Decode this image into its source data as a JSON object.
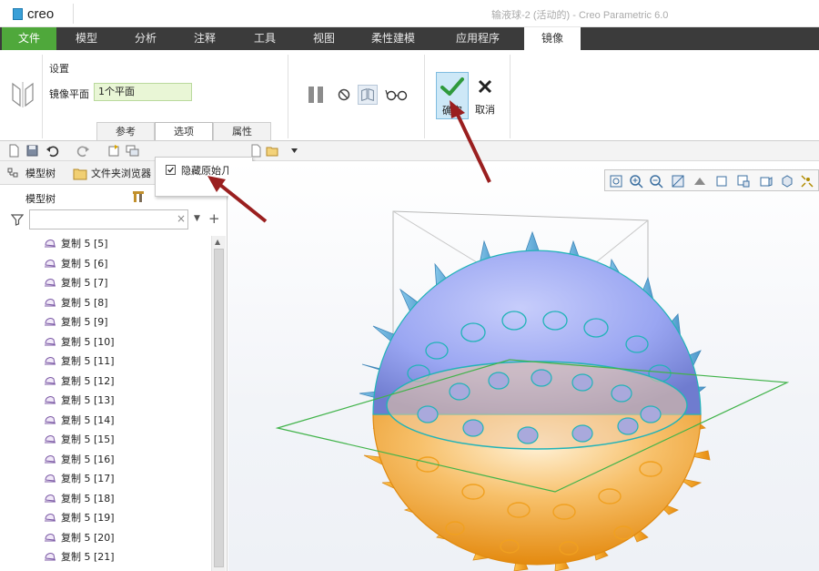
{
  "app": {
    "logo": "creo",
    "window_title": "输液球-2 (活动的) - Creo Parametric 6.0"
  },
  "ribbon_tabs": {
    "file": "文件",
    "model": "模型",
    "analysis": "分析",
    "annotate": "注释",
    "tools": "工具",
    "view": "视图",
    "flexible": "柔性建模",
    "apps": "应用程序",
    "mirror": "镜像"
  },
  "mirror_dashboard": {
    "settings_title": "设置",
    "plane_label": "镜像平面",
    "plane_value": "1个平面",
    "subtabs": [
      "参考",
      "选项",
      "属性"
    ],
    "active_subtab": "选项",
    "ok_label": "确定",
    "cancel_label": "取消",
    "option_hide_original": "隐藏原始几何",
    "option_hide_original_checked": true
  },
  "left_panel": {
    "tab_model_tree": "模型树",
    "tab_folder_browser": "文件夹浏览器",
    "tree_title": "模型树",
    "search_value": "",
    "items": [
      "复制 5 [5]",
      "复制 5 [6]",
      "复制 5 [7]",
      "复制 5 [8]",
      "复制 5 [9]",
      "复制 5 [10]",
      "复制 5 [11]",
      "复制 5 [12]",
      "复制 5 [13]",
      "复制 5 [14]",
      "复制 5 [15]",
      "复制 5 [16]",
      "复制 5 [17]",
      "复制 5 [18]",
      "复制 5 [19]",
      "复制 5 [20]",
      "复制 5 [21]"
    ]
  },
  "colors": {
    "file_tab": "#4fa83b",
    "ribbon_dark": "#3b3b3b",
    "ok_highlight": "#cde8f7",
    "plane_field": "#e9f6d6",
    "annotation_arrow": "#9a1f1f",
    "upper_hemisphere": "#9aa6f2",
    "lower_hemisphere": "#f6a21c",
    "edge_cyan": "#21b3b8"
  }
}
